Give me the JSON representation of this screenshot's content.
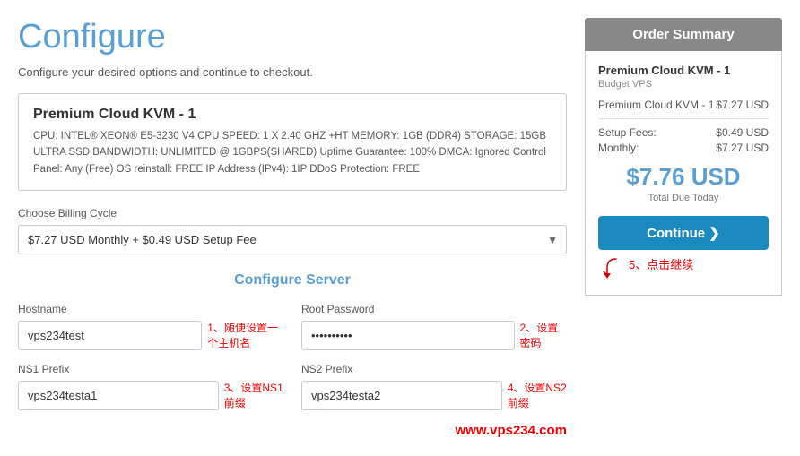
{
  "page": {
    "title": "Configure",
    "subtitle": "Configure your desired options and continue to checkout."
  },
  "product": {
    "name": "Premium Cloud KVM - 1",
    "specs": "CPU: INTEL® XEON® E5-3230 V4 CPU SPEED: 1 X 2.40 GHZ +HT MEMORY: 1GB (DDR4) STORAGE: 15GB ULTRA SSD BANDWIDTH: UNLIMITED @ 1GBPS(SHARED) Uptime Guarantee: 100% DMCA: Ignored Control Panel: Any (Free) OS reinstall: FREE IP Address (IPv4): 1IP DDoS Protection: FREE"
  },
  "billing": {
    "label": "Choose Billing Cycle",
    "option": "$7.27 USD Monthly + $0.49 USD Setup Fee"
  },
  "configure_server": {
    "title": "Configure Server",
    "hostname_label": "Hostname",
    "hostname_value": "vps234test",
    "hostname_annotation": "1、随便设置一个主机名",
    "password_label": "Root Password",
    "password_value": "••••••••••",
    "password_annotation": "2、设置密码",
    "ns1_label": "NS1 Prefix",
    "ns1_value": "vps234testa1",
    "ns1_annotation": "3、设置NS1前缀",
    "ns2_label": "NS2 Prefix",
    "ns2_value": "vps234testa2",
    "ns2_annotation": "4、设置NS2前缀"
  },
  "order_summary": {
    "header": "Order Summary",
    "product_name": "Premium Cloud KVM - 1",
    "product_sub": "Budget VPS",
    "product_price": "$7.27 USD",
    "setup_fees_label": "Setup Fees:",
    "setup_fees_value": "$0.49 USD",
    "monthly_label": "Monthly:",
    "monthly_value": "$7.27 USD",
    "total": "$7.76 USD",
    "total_label": "Total Due Today",
    "continue_label": "Continue ❯",
    "annotation_5": "5、点击继续"
  },
  "watermark": "www.vps234.com"
}
